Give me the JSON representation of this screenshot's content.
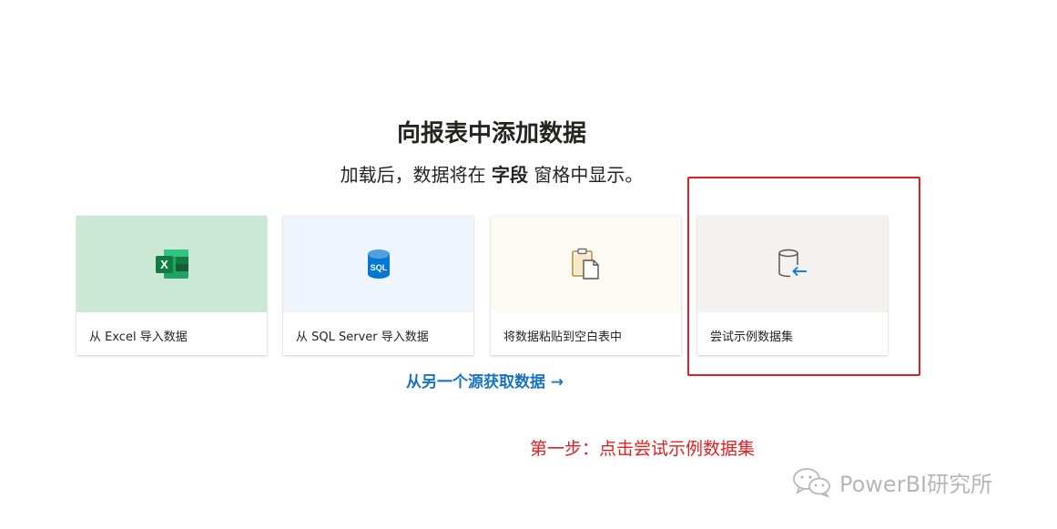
{
  "heading": "向报表中添加数据",
  "subtitle": {
    "prefix": "加载后，数据将在 ",
    "bold": "字段",
    "suffix": " 窗格中显示。"
  },
  "cards": [
    {
      "label": "从 Excel 导入数据",
      "icon": "excel-icon"
    },
    {
      "label": "从 SQL Server 导入数据",
      "icon": "sql-database-icon",
      "icon_text": "SQL"
    },
    {
      "label": "将数据粘贴到空白表中",
      "icon": "clipboard-paste-icon"
    },
    {
      "label": "尝试示例数据集",
      "icon": "sample-dataset-icon"
    }
  ],
  "another_source": "从另一个源获取数据 →",
  "annotation": "第一步：点击尝试示例数据集",
  "watermark": "PowerBI研究所",
  "colors": {
    "accent_link": "#1a73c0",
    "annotation_red": "#e02020",
    "excel_card_bg": "#cbe8d6",
    "sql_card_bg": "#eef5fc",
    "paste_card_bg": "#fcfbf3",
    "sample_card_bg": "#f3f2f1"
  }
}
